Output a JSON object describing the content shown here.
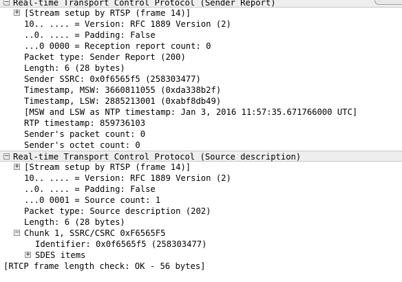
{
  "tree": {
    "sender_report": {
      "header": "Real-time Transport Control Protocol (Sender Report)",
      "stream_setup": "[Stream setup by RTSP (frame 14)]",
      "version": "10.. .... = Version: RFC 1889 Version (2)",
      "padding": "..0. .... = Padding: False",
      "reception_count": "...0 0000 = Reception report count: 0",
      "packet_type": "Packet type: Sender Report (200)",
      "length": "Length: 6 (28 bytes)",
      "sender_ssrc": "Sender SSRC: 0x0f6565f5 (258303477)",
      "timestamp_msw": "Timestamp, MSW: 3660811055 (0xda338b2f)",
      "timestamp_lsw": "Timestamp, LSW: 2885213001 (0xabf8db49)",
      "ntp_timestamp": "[MSW and LSW as NTP timestamp: Jan  3, 2016 11:57:35.671766000 UTC]",
      "rtp_timestamp": "RTP timestamp: 859736103",
      "packet_count": "Sender's packet count: 0",
      "octet_count": "Sender's octet count: 0"
    },
    "source_description": {
      "header": "Real-time Transport Control Protocol (Source description)",
      "stream_setup": "[Stream setup by RTSP (frame 14)]",
      "version": "10.. .... = Version: RFC 1889 Version (2)",
      "padding": "..0. .... = Padding: False",
      "source_count": "...0 0001 = Source count: 1",
      "packet_type": "Packet type: Source description (202)",
      "length": "Length: 6 (28 bytes)",
      "chunk": "Chunk 1, SSRC/CSRC 0xF6565F5",
      "identifier": "Identifier: 0x0f6565f5 (258303477)",
      "sdes_items": "SDES items"
    },
    "frame_length_check": "[RTCP frame length check: OK - 56 bytes]",
    "toggles": {
      "expanded": "⊟",
      "collapsed": "⊞"
    }
  }
}
